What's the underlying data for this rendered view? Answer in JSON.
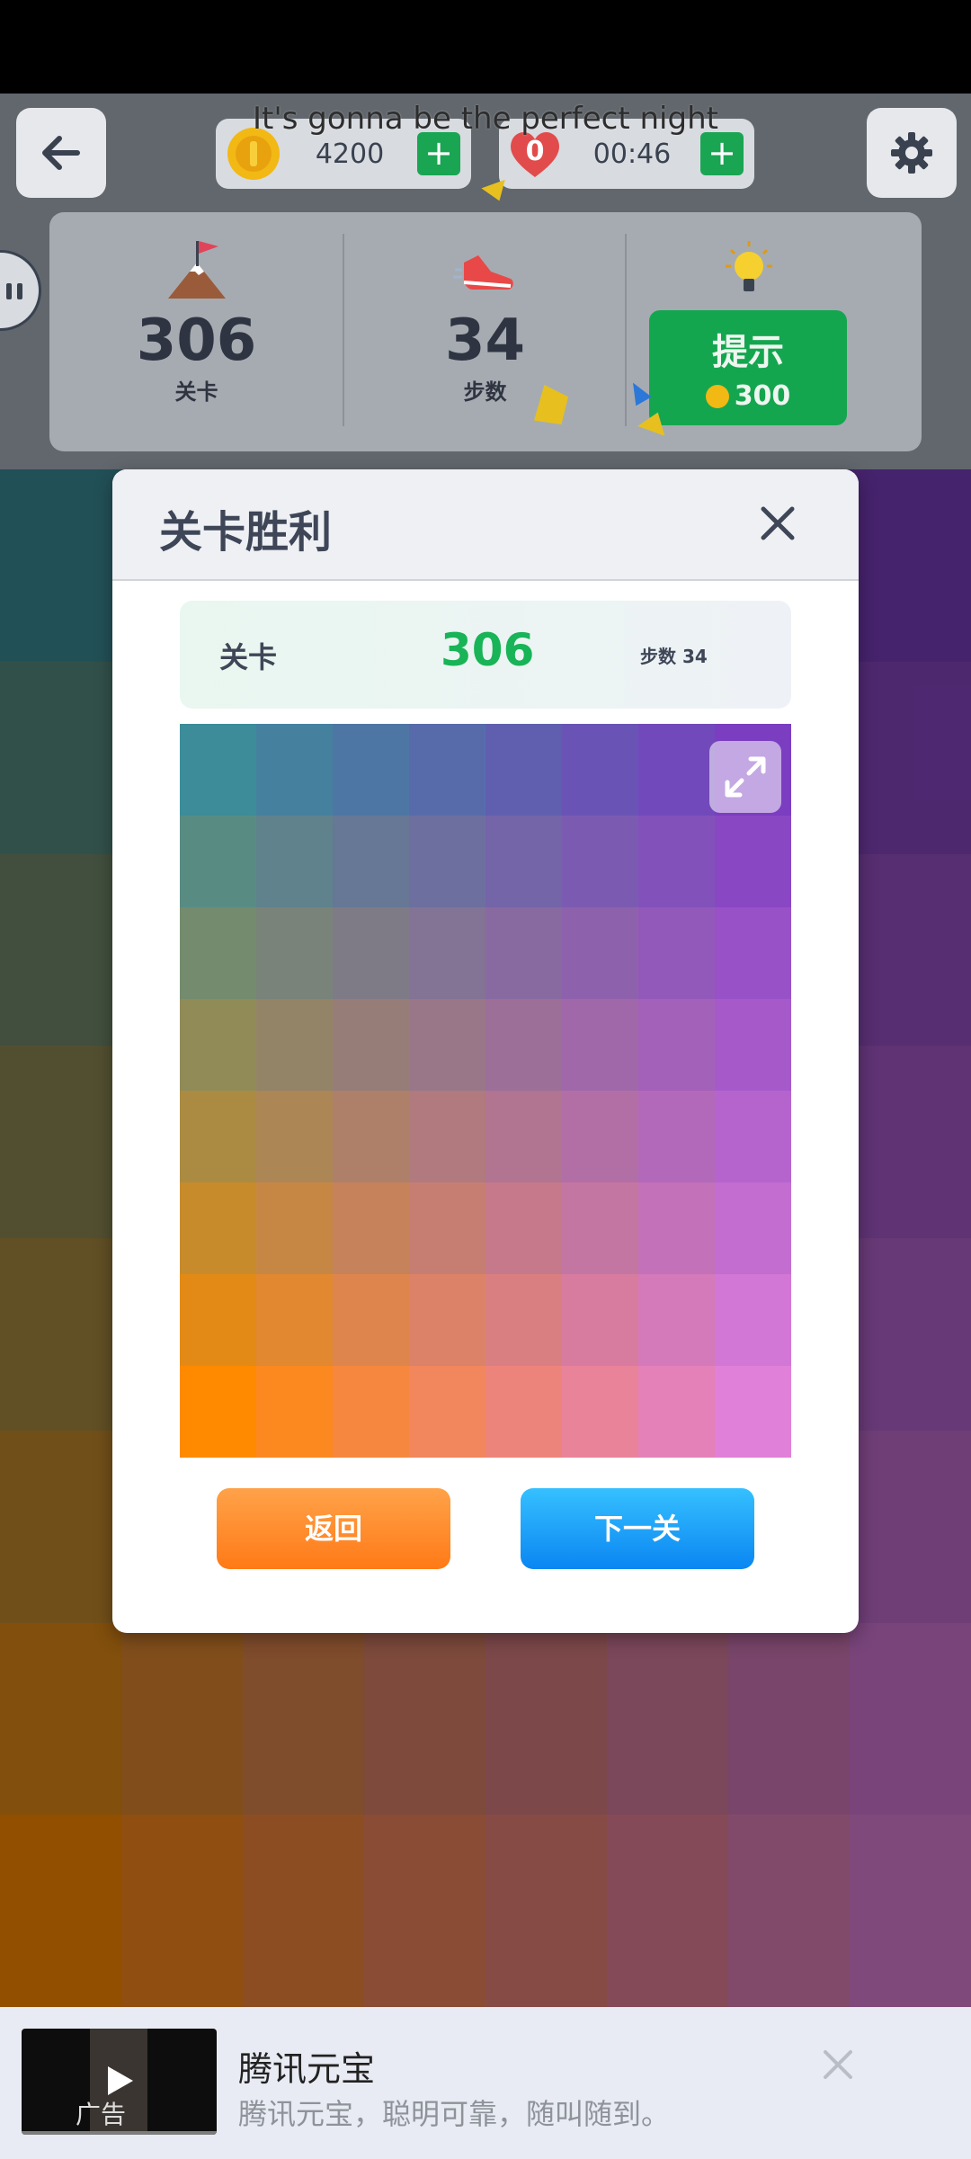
{
  "header": {
    "coins": "4200",
    "lives": "0",
    "timer": "00:46",
    "lyric": "It's gonna be the perfect night",
    "plus": "+"
  },
  "stats": {
    "level_value": "306",
    "level_label": "关卡",
    "moves_value": "34",
    "moves_label": "步数",
    "hint_label": "提示",
    "hint_cost": "300"
  },
  "modal": {
    "title": "关卡胜利",
    "level_label": "关卡",
    "level_number": "306",
    "moves_text": "步数 34",
    "back_label": "返回",
    "next_label": "下一关"
  },
  "ad": {
    "title": "腾讯元宝",
    "description": "腾讯元宝，聪明可靠，随叫随到。",
    "tag": "广告"
  },
  "colors": {
    "grid_top_left": "#3c8c99",
    "grid_top_right": "#7b3ec0",
    "grid_bottom_left": "#ff8a00",
    "grid_bottom_right": "#e080d8",
    "green": "#14a64f",
    "orange": "#ff7a16",
    "blue": "#0a86f2"
  },
  "icons": [
    "back-arrow-icon",
    "gear-icon",
    "coin-icon",
    "heart-icon",
    "flag-mountain-icon",
    "sneaker-icon",
    "lightbulb-icon",
    "expand-icon",
    "close-icon",
    "play-icon"
  ]
}
